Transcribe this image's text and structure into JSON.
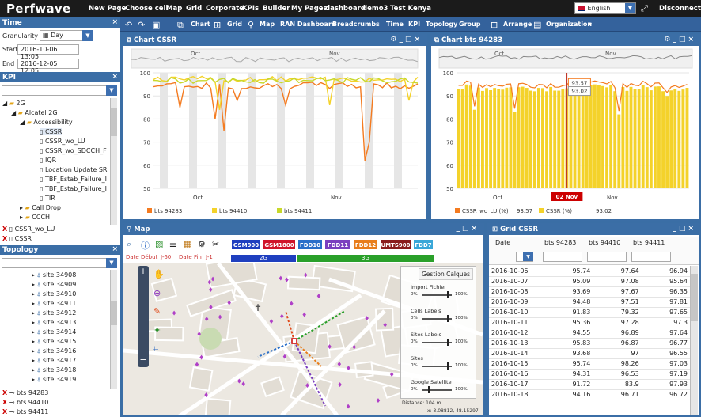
{
  "app": {
    "logo": "Perfwave"
  },
  "topnav": [
    "New Page",
    "Choose cell",
    "Map",
    "Grid",
    "Corporate",
    "KPIs",
    "Builder",
    "My Pages",
    "dashboard",
    "demo3",
    "Test Kenya"
  ],
  "language": "English",
  "disconnect": "Disconnect",
  "toolbar": {
    "chart": "Chart",
    "grid": "Grid",
    "map": "Map",
    "ran": "RAN Dashboard",
    "breadcrumbs": "Breadcrumbs",
    "time": "Time",
    "kpi": "KPI",
    "topology": "Topology",
    "group": "Group",
    "arrange": "Arrange",
    "organization": "Organization"
  },
  "time_panel": {
    "title": "Time",
    "granularity_label": "Granularity",
    "granularity": "Day",
    "start_label": "Start",
    "start": "2016-10-06 13:05",
    "end_label": "End",
    "end": "2016-12-05 12:05"
  },
  "kpi_panel": {
    "title": "KPI",
    "tree": [
      "2G",
      "Alcatel 2G",
      "Accessibility",
      "CSSR",
      "CSSR_wo_LU",
      "CSSR_wo_SDCCH_F",
      "IQR",
      "Location Update SR",
      "TBF_Estab_Failure_I",
      "TBF_Estab_Failure_I",
      "TIR",
      "Call Drop",
      "CCCH"
    ],
    "selected": [
      "CSSR_wo_LU",
      "CSSR"
    ]
  },
  "topology_panel": {
    "title": "Topology",
    "sites": [
      "site 34908",
      "site 34909",
      "site 34910",
      "site 34911",
      "site 34912",
      "site 34913",
      "site 34914",
      "site 34915",
      "site 34916",
      "site 34917",
      "site 34918",
      "site 34919"
    ],
    "selected": [
      "bts 94283",
      "bts 94410",
      "bts 94411"
    ]
  },
  "chart1": {
    "title": "Chart CSSR",
    "legend": [
      "bts 94283",
      "bts 94410",
      "bts 94411"
    ],
    "colors": [
      "#f47b20",
      "#f4d22a",
      "#c8d82a"
    ],
    "yticks": [
      "100",
      "90",
      "80",
      "70",
      "60",
      "50"
    ],
    "xticks": [
      "Oct",
      "Nov"
    ],
    "nav": [
      "Oct",
      "Nov"
    ]
  },
  "chart2": {
    "title": "Chart bts 94283",
    "legend": [
      "CSSR_wo_LU (%)",
      "CSSR (%)"
    ],
    "legend_vals": [
      "93.57",
      "93.02"
    ],
    "tooltips": [
      "93.57",
      "93.02"
    ],
    "xticks": [
      "Oct",
      "02 Nov",
      "Nov"
    ],
    "yticks": [
      "100",
      "90",
      "80",
      "70",
      "60",
      "50"
    ],
    "nav": [
      "Oct",
      "Nov"
    ]
  },
  "map": {
    "title": "Map",
    "bands": [
      {
        "label": "GSM900",
        "color": "#1f3fbf"
      },
      {
        "label": "GSM1800",
        "color": "#d0142a"
      },
      {
        "label": "FDD10",
        "color": "#2a6fc9"
      },
      {
        "label": "FDD11",
        "color": "#7b3fbf"
      },
      {
        "label": "FDD12",
        "color": "#e87e1c"
      },
      {
        "label": "UMTS900",
        "color": "#8a1c1c"
      },
      {
        "label": "FDD7",
        "color": "#3aa7d8"
      }
    ],
    "tech2g": "2G",
    "tech3g": "3G",
    "date_debut": "Date Début",
    "date_fin": "Date Fin",
    "j60": "J-60",
    "j1": "J-1",
    "layers_title": "Gestion Calques",
    "layers": [
      "Import Fichier",
      "Cells Labels",
      "Sites Labels",
      "Sites",
      "Google Satellite"
    ],
    "pct0": "0%",
    "pct100": "100%",
    "distance": "Distance: 104 m",
    "coords": "x: 3.08812, 48.15297"
  },
  "grid": {
    "title": "Grid CSSR",
    "columns": [
      "Date",
      "bts 94283",
      "bts 94410",
      "bts 94411"
    ],
    "rows": [
      [
        "2016-10-06",
        "95.74",
        "97.64",
        "96.94"
      ],
      [
        "2016-10-07",
        "95.09",
        "97.08",
        "95.64"
      ],
      [
        "2016-10-08",
        "93.69",
        "97.67",
        "96.35"
      ],
      [
        "2016-10-09",
        "94.48",
        "97.51",
        "97.81"
      ],
      [
        "2016-10-10",
        "91.83",
        "79.32",
        "97.65"
      ],
      [
        "2016-10-11",
        "95.36",
        "97.28",
        "97.3"
      ],
      [
        "2016-10-12",
        "94.55",
        "96.89",
        "97.64"
      ],
      [
        "2016-10-13",
        "95.83",
        "96.87",
        "96.77"
      ],
      [
        "2016-10-14",
        "93.68",
        "97",
        "96.55"
      ],
      [
        "2016-10-15",
        "95.74",
        "98.26",
        "97.03"
      ],
      [
        "2016-10-16",
        "94.31",
        "96.53",
        "97.19"
      ],
      [
        "2016-10-17",
        "91.72",
        "83.9",
        "97.93"
      ],
      [
        "2016-10-18",
        "94.16",
        "96.71",
        "96.72"
      ]
    ]
  }
}
